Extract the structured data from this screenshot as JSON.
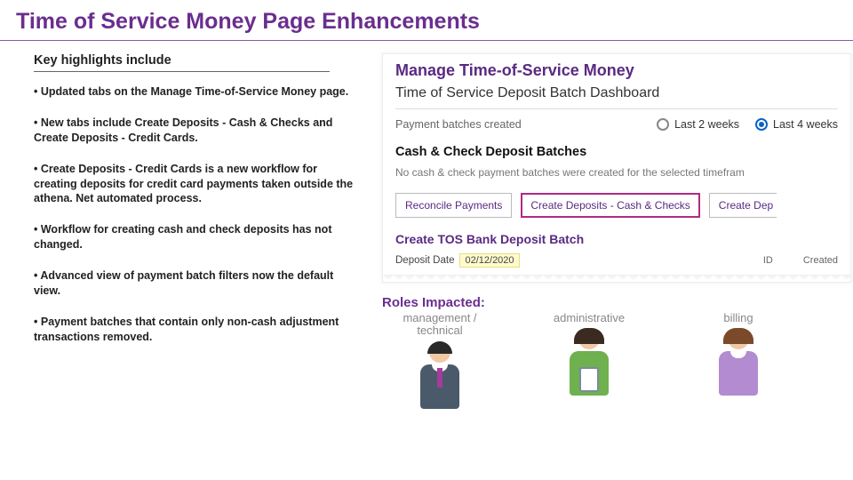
{
  "title": "Time of Service Money Page Enhancements",
  "subhead": "Key highlights include",
  "bullets": [
    "Updated tabs on the Manage Time-of-Service Money page.",
    "New tabs include Create Deposits - Cash & Checks and Create Deposits - Credit Cards.",
    "Create Deposits - Credit Cards is a new workflow for creating deposits for credit card payments taken outside the athena. Net automated process.",
    "Workflow for creating cash and check deposits has not changed.",
    "Advanced view of payment batch filters now the default view.",
    "Payment batches that contain only non-cash adjustment transactions removed."
  ],
  "screenshot": {
    "title": "Manage Time-of-Service Money",
    "subtitle": "Time of Service Deposit Batch Dashboard",
    "filter_label": "Payment batches created",
    "radios": [
      {
        "label": "Last 2 weeks",
        "selected": false
      },
      {
        "label": "Last 4 weeks",
        "selected": true
      }
    ],
    "section": "Cash & Check Deposit Batches",
    "empty": "No cash & check payment batches were created for the selected timefram",
    "tabs": [
      {
        "label": "Reconcile Payments",
        "highlight": false
      },
      {
        "label": "Create Deposits - Cash & Checks",
        "highlight": true
      },
      {
        "label": "Create Dep",
        "highlight": false,
        "cut": true
      }
    ],
    "batch_title": "Create TOS Bank Deposit Batch",
    "deposit_label": "Deposit Date",
    "deposit_value": "02/12/2020",
    "col_id": "ID",
    "col_created": "Created"
  },
  "roles_title": "Roles Impacted:",
  "roles": [
    {
      "label": "management / technical"
    },
    {
      "label": "administrative"
    },
    {
      "label": "billing"
    }
  ]
}
